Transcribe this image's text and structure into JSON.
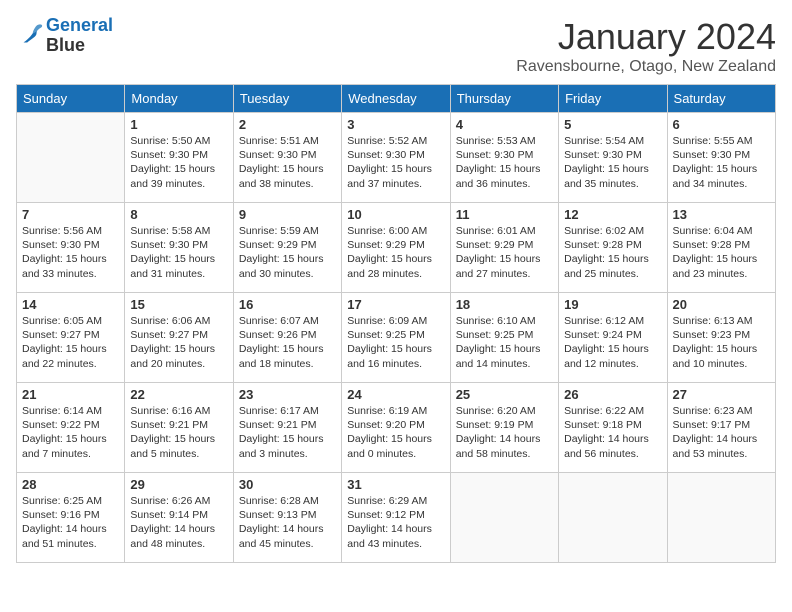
{
  "header": {
    "logo_line1": "General",
    "logo_line2": "Blue",
    "title": "January 2024",
    "subtitle": "Ravensbourne, Otago, New Zealand"
  },
  "weekdays": [
    "Sunday",
    "Monday",
    "Tuesday",
    "Wednesday",
    "Thursday",
    "Friday",
    "Saturday"
  ],
  "weeks": [
    [
      {
        "day": "",
        "sunrise": "",
        "sunset": "",
        "daylight": ""
      },
      {
        "day": "1",
        "sunrise": "Sunrise: 5:50 AM",
        "sunset": "Sunset: 9:30 PM",
        "daylight": "Daylight: 15 hours and 39 minutes."
      },
      {
        "day": "2",
        "sunrise": "Sunrise: 5:51 AM",
        "sunset": "Sunset: 9:30 PM",
        "daylight": "Daylight: 15 hours and 38 minutes."
      },
      {
        "day": "3",
        "sunrise": "Sunrise: 5:52 AM",
        "sunset": "Sunset: 9:30 PM",
        "daylight": "Daylight: 15 hours and 37 minutes."
      },
      {
        "day": "4",
        "sunrise": "Sunrise: 5:53 AM",
        "sunset": "Sunset: 9:30 PM",
        "daylight": "Daylight: 15 hours and 36 minutes."
      },
      {
        "day": "5",
        "sunrise": "Sunrise: 5:54 AM",
        "sunset": "Sunset: 9:30 PM",
        "daylight": "Daylight: 15 hours and 35 minutes."
      },
      {
        "day": "6",
        "sunrise": "Sunrise: 5:55 AM",
        "sunset": "Sunset: 9:30 PM",
        "daylight": "Daylight: 15 hours and 34 minutes."
      }
    ],
    [
      {
        "day": "7",
        "sunrise": "Sunrise: 5:56 AM",
        "sunset": "Sunset: 9:30 PM",
        "daylight": "Daylight: 15 hours and 33 minutes."
      },
      {
        "day": "8",
        "sunrise": "Sunrise: 5:58 AM",
        "sunset": "Sunset: 9:30 PM",
        "daylight": "Daylight: 15 hours and 31 minutes."
      },
      {
        "day": "9",
        "sunrise": "Sunrise: 5:59 AM",
        "sunset": "Sunset: 9:29 PM",
        "daylight": "Daylight: 15 hours and 30 minutes."
      },
      {
        "day": "10",
        "sunrise": "Sunrise: 6:00 AM",
        "sunset": "Sunset: 9:29 PM",
        "daylight": "Daylight: 15 hours and 28 minutes."
      },
      {
        "day": "11",
        "sunrise": "Sunrise: 6:01 AM",
        "sunset": "Sunset: 9:29 PM",
        "daylight": "Daylight: 15 hours and 27 minutes."
      },
      {
        "day": "12",
        "sunrise": "Sunrise: 6:02 AM",
        "sunset": "Sunset: 9:28 PM",
        "daylight": "Daylight: 15 hours and 25 minutes."
      },
      {
        "day": "13",
        "sunrise": "Sunrise: 6:04 AM",
        "sunset": "Sunset: 9:28 PM",
        "daylight": "Daylight: 15 hours and 23 minutes."
      }
    ],
    [
      {
        "day": "14",
        "sunrise": "Sunrise: 6:05 AM",
        "sunset": "Sunset: 9:27 PM",
        "daylight": "Daylight: 15 hours and 22 minutes."
      },
      {
        "day": "15",
        "sunrise": "Sunrise: 6:06 AM",
        "sunset": "Sunset: 9:27 PM",
        "daylight": "Daylight: 15 hours and 20 minutes."
      },
      {
        "day": "16",
        "sunrise": "Sunrise: 6:07 AM",
        "sunset": "Sunset: 9:26 PM",
        "daylight": "Daylight: 15 hours and 18 minutes."
      },
      {
        "day": "17",
        "sunrise": "Sunrise: 6:09 AM",
        "sunset": "Sunset: 9:25 PM",
        "daylight": "Daylight: 15 hours and 16 minutes."
      },
      {
        "day": "18",
        "sunrise": "Sunrise: 6:10 AM",
        "sunset": "Sunset: 9:25 PM",
        "daylight": "Daylight: 15 hours and 14 minutes."
      },
      {
        "day": "19",
        "sunrise": "Sunrise: 6:12 AM",
        "sunset": "Sunset: 9:24 PM",
        "daylight": "Daylight: 15 hours and 12 minutes."
      },
      {
        "day": "20",
        "sunrise": "Sunrise: 6:13 AM",
        "sunset": "Sunset: 9:23 PM",
        "daylight": "Daylight: 15 hours and 10 minutes."
      }
    ],
    [
      {
        "day": "21",
        "sunrise": "Sunrise: 6:14 AM",
        "sunset": "Sunset: 9:22 PM",
        "daylight": "Daylight: 15 hours and 7 minutes."
      },
      {
        "day": "22",
        "sunrise": "Sunrise: 6:16 AM",
        "sunset": "Sunset: 9:21 PM",
        "daylight": "Daylight: 15 hours and 5 minutes."
      },
      {
        "day": "23",
        "sunrise": "Sunrise: 6:17 AM",
        "sunset": "Sunset: 9:21 PM",
        "daylight": "Daylight: 15 hours and 3 minutes."
      },
      {
        "day": "24",
        "sunrise": "Sunrise: 6:19 AM",
        "sunset": "Sunset: 9:20 PM",
        "daylight": "Daylight: 15 hours and 0 minutes."
      },
      {
        "day": "25",
        "sunrise": "Sunrise: 6:20 AM",
        "sunset": "Sunset: 9:19 PM",
        "daylight": "Daylight: 14 hours and 58 minutes."
      },
      {
        "day": "26",
        "sunrise": "Sunrise: 6:22 AM",
        "sunset": "Sunset: 9:18 PM",
        "daylight": "Daylight: 14 hours and 56 minutes."
      },
      {
        "day": "27",
        "sunrise": "Sunrise: 6:23 AM",
        "sunset": "Sunset: 9:17 PM",
        "daylight": "Daylight: 14 hours and 53 minutes."
      }
    ],
    [
      {
        "day": "28",
        "sunrise": "Sunrise: 6:25 AM",
        "sunset": "Sunset: 9:16 PM",
        "daylight": "Daylight: 14 hours and 51 minutes."
      },
      {
        "day": "29",
        "sunrise": "Sunrise: 6:26 AM",
        "sunset": "Sunset: 9:14 PM",
        "daylight": "Daylight: 14 hours and 48 minutes."
      },
      {
        "day": "30",
        "sunrise": "Sunrise: 6:28 AM",
        "sunset": "Sunset: 9:13 PM",
        "daylight": "Daylight: 14 hours and 45 minutes."
      },
      {
        "day": "31",
        "sunrise": "Sunrise: 6:29 AM",
        "sunset": "Sunset: 9:12 PM",
        "daylight": "Daylight: 14 hours and 43 minutes."
      },
      {
        "day": "",
        "sunrise": "",
        "sunset": "",
        "daylight": ""
      },
      {
        "day": "",
        "sunrise": "",
        "sunset": "",
        "daylight": ""
      },
      {
        "day": "",
        "sunrise": "",
        "sunset": "",
        "daylight": ""
      }
    ]
  ]
}
